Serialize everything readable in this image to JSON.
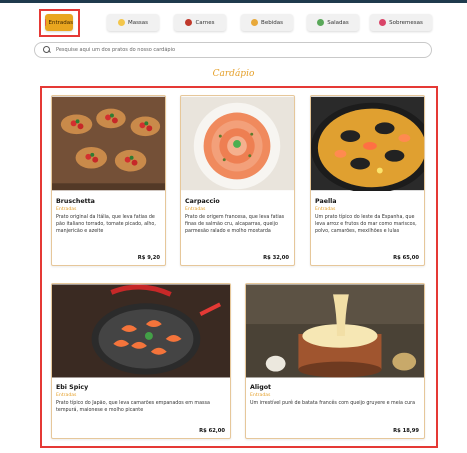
{
  "colors": {
    "accent": "#e9a61f",
    "title": "#e5a02a",
    "highlight": "#e53935"
  },
  "categories": [
    {
      "label": "Entradas",
      "icon": "appetizer-icon",
      "active": true
    },
    {
      "label": "Massas",
      "icon": "pasta-icon",
      "active": false
    },
    {
      "label": "Carnes",
      "icon": "meat-icon",
      "active": false
    },
    {
      "label": "Bebidas",
      "icon": "drink-icon",
      "active": false
    },
    {
      "label": "Saladas",
      "icon": "salad-icon",
      "active": false
    },
    {
      "label": "Sobremesas",
      "icon": "dessert-icon",
      "active": false
    }
  ],
  "search": {
    "placeholder": "Pesquise aqui um dos pratos do nosso cardápio"
  },
  "menu": {
    "title": "Cardápio",
    "cards": [
      {
        "name": "Bruschetta",
        "category": "Entradas",
        "description": "Prato original da Itália, que leva fatias de pão italiano torrado, tomate picado, alho, manjericão e azeite",
        "price": "R$ 9,20",
        "image": "bruschetta-image"
      },
      {
        "name": "Carpaccio",
        "category": "Entradas",
        "description": "Prato de origem francesa, que leva fatias finas de salmão cru, alcaparras, queijo parmesão ralado e molho mostarda",
        "price": "R$ 32,00",
        "image": "carpaccio-image"
      },
      {
        "name": "Paella",
        "category": "Entradas",
        "description": "Um prato típico do leste da Espanha, que leva arroz e frutos do mar como mariscos, polvo, camarões, mexilhões e lulas",
        "price": "R$ 65,00",
        "image": "paella-image"
      },
      {
        "name": "Ebi Spicy",
        "category": "Entradas",
        "description": "Prato típico do Japão, que leva camarões empanados em massa tempurá, maionese e molho picante",
        "price": "R$ 62,00",
        "image": "ebi-spicy-image"
      },
      {
        "name": "Aligot",
        "category": "Entradas",
        "description": "Um irrestível purê de batata francês com queijo gruyere e meia cura",
        "price": "R$ 18,99",
        "image": "aligot-image"
      }
    ]
  }
}
